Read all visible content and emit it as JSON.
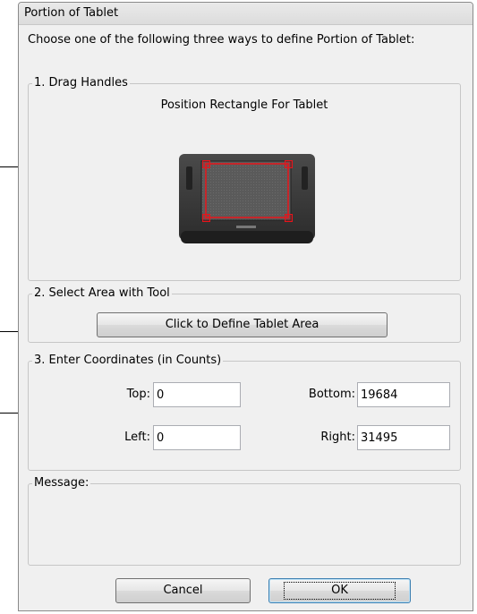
{
  "window": {
    "title": "Portion of Tablet"
  },
  "instructions": "Choose one of the following three ways to define Portion of Tablet:",
  "drag_handles": {
    "legend": "1. Drag Handles",
    "subheading": "Position Rectangle For Tablet"
  },
  "select_area": {
    "legend": "2. Select Area with Tool",
    "button_label": "Click to Define Tablet Area"
  },
  "coordinates": {
    "legend": "3. Enter Coordinates (in Counts)",
    "top_label": "Top:",
    "top_value": "0",
    "bottom_label": "Bottom:",
    "bottom_value": "19684",
    "left_label": "Left:",
    "left_value": "0",
    "right_label": "Right:",
    "right_value": "31495"
  },
  "message": {
    "legend": "Message:"
  },
  "buttons": {
    "cancel": "Cancel",
    "ok": "OK"
  },
  "colors": {
    "handle": "#e8141b",
    "tablet_body": "#3a3a3a",
    "window_bg": "#f0f0f0"
  }
}
